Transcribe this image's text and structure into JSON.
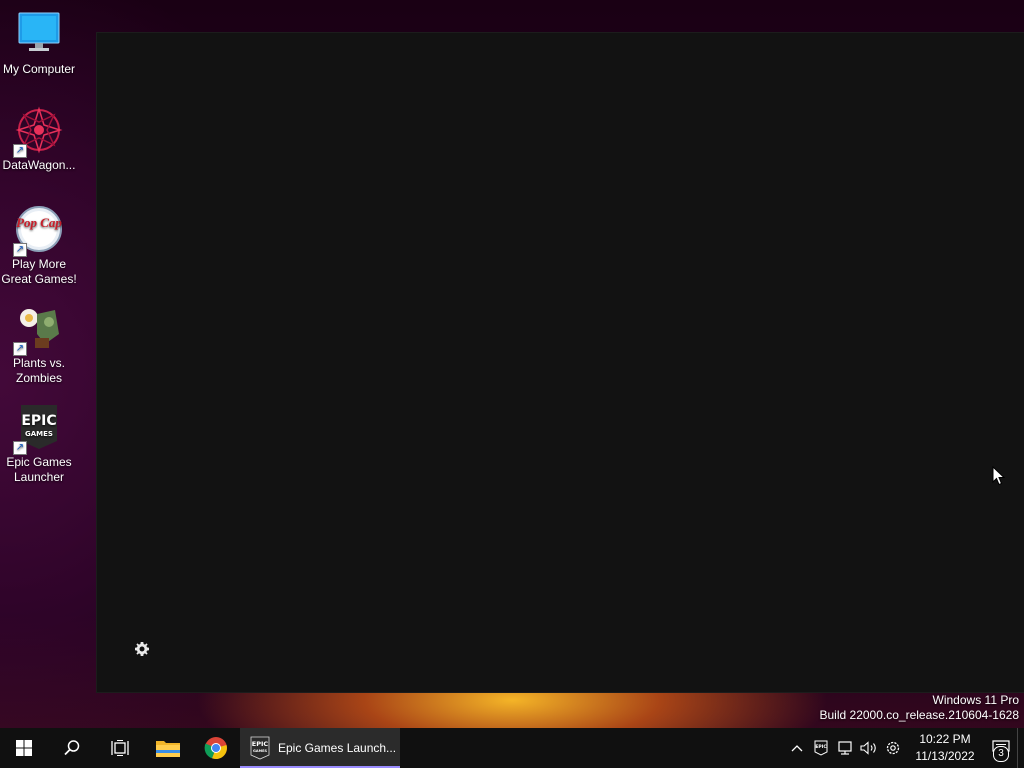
{
  "desktop": {
    "icons": [
      {
        "label": "My Computer",
        "icon": "monitor-icon"
      },
      {
        "label": "DataWagon...",
        "icon": "datawagon-icon",
        "shortcut": true
      },
      {
        "label": "Play More Great Games!",
        "icon": "popcap-icon",
        "icon_text": "Pop Cap",
        "shortcut": true
      },
      {
        "label": "Plants vs. Zombies",
        "icon": "plants-vs-zombies-icon",
        "shortcut": true
      },
      {
        "label": "Epic Games Launcher",
        "icon": "epic-games-icon",
        "icon_text": "EPIC GAMES",
        "shortcut": true
      }
    ]
  },
  "launcher": {
    "settings_icon": "gear-icon"
  },
  "watermark": {
    "line1": "Windows 11 Pro",
    "line2": "Build 22000.co_release.210604-1628"
  },
  "taskbar": {
    "running_app_label": "Epic Games Launch...",
    "clock_time": "10:22 PM",
    "clock_date": "11/13/2022",
    "notification_count": "3",
    "accent_color": "#9a8cff"
  }
}
